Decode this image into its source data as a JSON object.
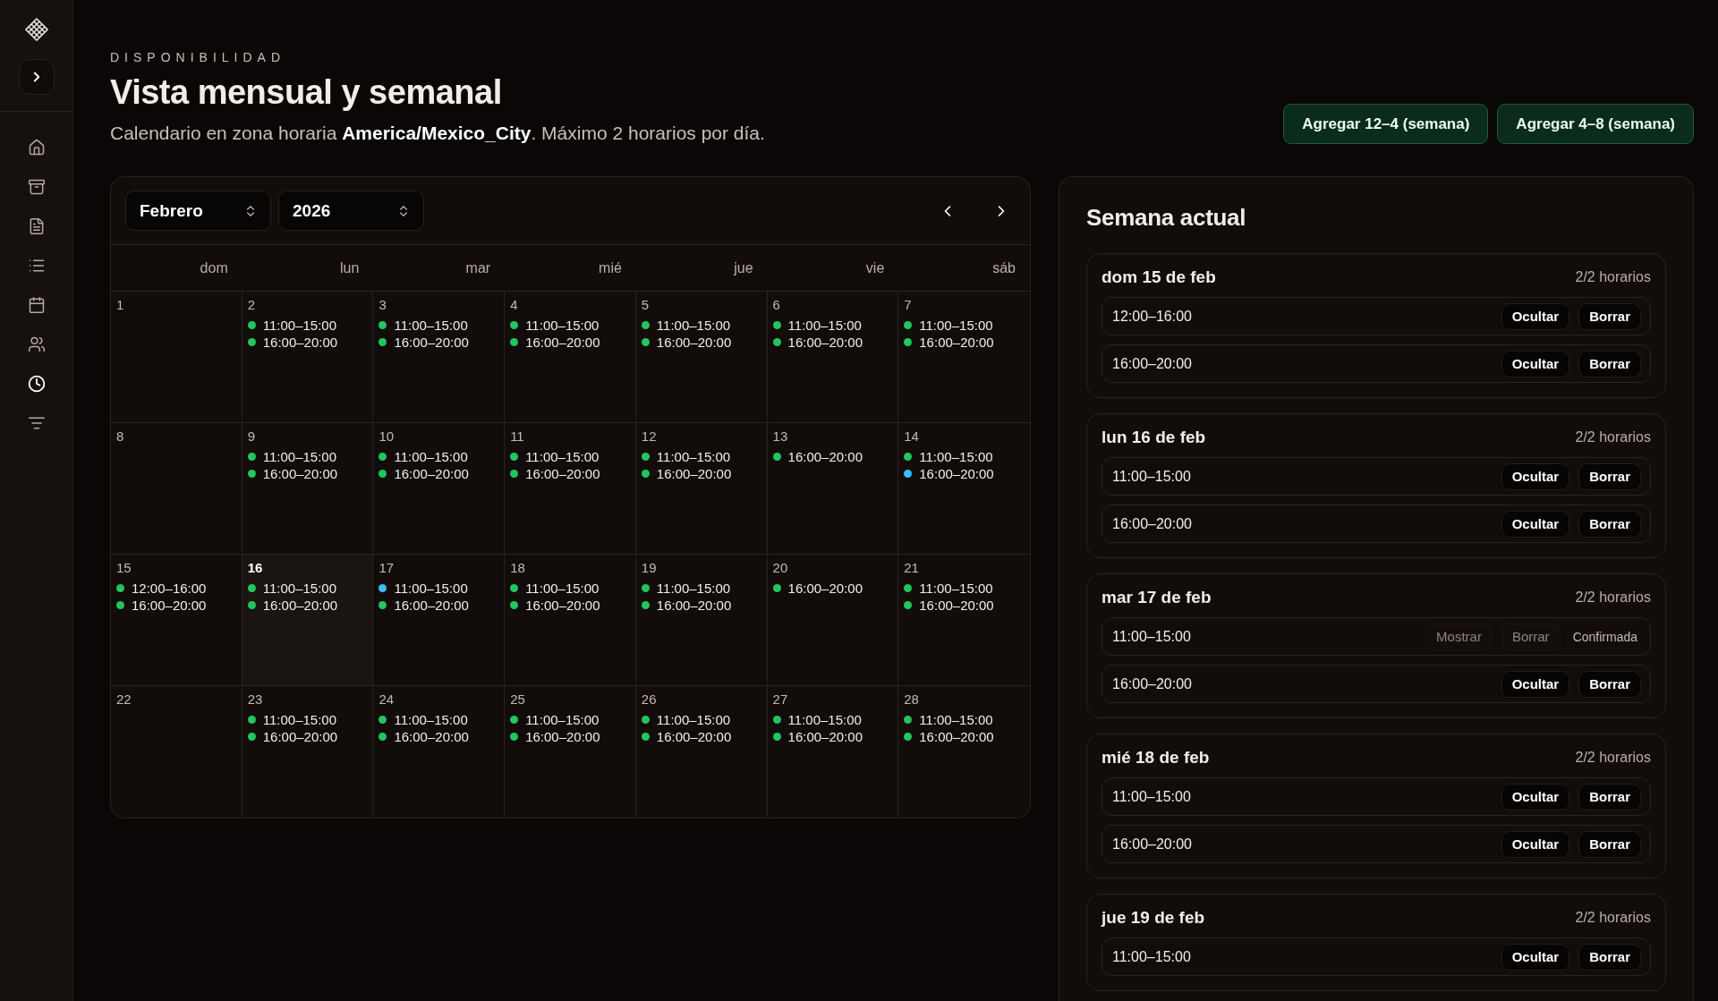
{
  "sidebar": {
    "items": [
      {
        "kind": "home",
        "selected": false
      },
      {
        "kind": "archive",
        "selected": false
      },
      {
        "kind": "file",
        "selected": false
      },
      {
        "kind": "list",
        "selected": false
      },
      {
        "kind": "calendar",
        "selected": false
      },
      {
        "kind": "users",
        "selected": false
      },
      {
        "kind": "clock",
        "selected": true
      },
      {
        "kind": "lines",
        "selected": false
      }
    ]
  },
  "header": {
    "eyebrow": "DISPONIBILIDAD",
    "title": "Vista mensual y semanal",
    "subtitle": "Calendario en zona horaria **America/Mexico_City**. Máximo 2 horarios por día.",
    "buttons": [
      "Agregar 12–4 (semana)",
      "Agregar 4–8 (semana)"
    ]
  },
  "calendar": {
    "month_select": "Febrero",
    "year_select": "2026",
    "weekdays": [
      "dom",
      "lun",
      "mar",
      "mié",
      "jue",
      "vie",
      "sáb"
    ],
    "weeks": [
      [
        {
          "day": "1",
          "today": false
        },
        {
          "day": "2",
          "today": false,
          "slots": [
            {
              "time": "11:00–15:00",
              "color": "#22c55e"
            },
            {
              "time": "16:00–20:00",
              "color": "#22c55e"
            }
          ]
        },
        {
          "day": "3",
          "today": false,
          "slots": [
            {
              "time": "11:00–15:00",
              "color": "#22c55e"
            },
            {
              "time": "16:00–20:00",
              "color": "#22c55e"
            }
          ]
        },
        {
          "day": "4",
          "today": false,
          "slots": [
            {
              "time": "11:00–15:00",
              "color": "#22c55e"
            },
            {
              "time": "16:00–20:00",
              "color": "#22c55e"
            }
          ]
        },
        {
          "day": "5",
          "today": false,
          "slots": [
            {
              "time": "11:00–15:00",
              "color": "#22c55e"
            },
            {
              "time": "16:00–20:00",
              "color": "#22c55e"
            }
          ]
        },
        {
          "day": "6",
          "today": false,
          "slots": [
            {
              "time": "11:00–15:00",
              "color": "#22c55e"
            },
            {
              "time": "16:00–20:00",
              "color": "#22c55e"
            }
          ]
        },
        {
          "day": "7",
          "today": false,
          "slots": [
            {
              "time": "11:00–15:00",
              "color": "#22c55e"
            },
            {
              "time": "16:00–20:00",
              "color": "#22c55e"
            }
          ]
        }
      ],
      [
        {
          "day": "8",
          "today": false
        },
        {
          "day": "9",
          "today": false,
          "slots": [
            {
              "time": "11:00–15:00",
              "color": "#22c55e"
            },
            {
              "time": "16:00–20:00",
              "color": "#22c55e"
            }
          ]
        },
        {
          "day": "10",
          "today": false,
          "slots": [
            {
              "time": "11:00–15:00",
              "color": "#22c55e"
            },
            {
              "time": "16:00–20:00",
              "color": "#22c55e"
            }
          ]
        },
        {
          "day": "11",
          "today": false,
          "slots": [
            {
              "time": "11:00–15:00",
              "color": "#22c55e"
            },
            {
              "time": "16:00–20:00",
              "color": "#22c55e"
            }
          ]
        },
        {
          "day": "12",
          "today": false,
          "slots": [
            {
              "time": "11:00–15:00",
              "color": "#22c55e"
            },
            {
              "time": "16:00–20:00",
              "color": "#22c55e"
            }
          ]
        },
        {
          "day": "13",
          "today": false,
          "slots": [
            {
              "time": "16:00–20:00",
              "color": "#22c55e"
            }
          ]
        },
        {
          "day": "14",
          "today": false,
          "slots": [
            {
              "time": "11:00–15:00",
              "color": "#22c55e"
            },
            {
              "time": "16:00–20:00",
              "color": "#38bdf8"
            }
          ]
        }
      ],
      [
        {
          "day": "15",
          "today": false,
          "slots": [
            {
              "time": "12:00–16:00",
              "color": "#22c55e"
            },
            {
              "time": "16:00–20:00",
              "color": "#22c55e"
            }
          ]
        },
        {
          "day": "16",
          "today": true,
          "slots": [
            {
              "time": "11:00–15:00",
              "color": "#22c55e"
            },
            {
              "time": "16:00–20:00",
              "color": "#22c55e"
            }
          ]
        },
        {
          "day": "17",
          "today": false,
          "slots": [
            {
              "time": "11:00–15:00",
              "color": "#38bdf8"
            },
            {
              "time": "16:00–20:00",
              "color": "#22c55e"
            }
          ]
        },
        {
          "day": "18",
          "today": false,
          "slots": [
            {
              "time": "11:00–15:00",
              "color": "#22c55e"
            },
            {
              "time": "16:00–20:00",
              "color": "#22c55e"
            }
          ]
        },
        {
          "day": "19",
          "today": false,
          "slots": [
            {
              "time": "11:00–15:00",
              "color": "#22c55e"
            },
            {
              "time": "16:00–20:00",
              "color": "#22c55e"
            }
          ]
        },
        {
          "day": "20",
          "today": false,
          "slots": [
            {
              "time": "16:00–20:00",
              "color": "#22c55e"
            }
          ]
        },
        {
          "day": "21",
          "today": false,
          "slots": [
            {
              "time": "11:00–15:00",
              "color": "#22c55e"
            },
            {
              "time": "16:00–20:00",
              "color": "#22c55e"
            }
          ]
        }
      ],
      [
        {
          "day": "22",
          "today": false
        },
        {
          "day": "23",
          "today": false,
          "slots": [
            {
              "time": "11:00–15:00",
              "color": "#22c55e"
            },
            {
              "time": "16:00–20:00",
              "color": "#22c55e"
            }
          ]
        },
        {
          "day": "24",
          "today": false,
          "slots": [
            {
              "time": "11:00–15:00",
              "color": "#22c55e"
            },
            {
              "time": "16:00–20:00",
              "color": "#22c55e"
            }
          ]
        },
        {
          "day": "25",
          "today": false,
          "slots": [
            {
              "time": "11:00–15:00",
              "color": "#22c55e"
            },
            {
              "time": "16:00–20:00",
              "color": "#22c55e"
            }
          ]
        },
        {
          "day": "26",
          "today": false,
          "slots": [
            {
              "time": "11:00–15:00",
              "color": "#22c55e"
            },
            {
              "time": "16:00–20:00",
              "color": "#22c55e"
            }
          ]
        },
        {
          "day": "27",
          "today": false,
          "slots": [
            {
              "time": "11:00–15:00",
              "color": "#22c55e"
            },
            {
              "time": "16:00–20:00",
              "color": "#22c55e"
            }
          ]
        },
        {
          "day": "28",
          "today": false,
          "slots": [
            {
              "time": "11:00–15:00",
              "color": "#22c55e"
            },
            {
              "time": "16:00–20:00",
              "color": "#22c55e"
            }
          ]
        }
      ]
    ]
  },
  "week_panel": {
    "title": "Semana actual",
    "days": [
      {
        "title": "dom 15 de feb",
        "count": "2/2 horarios",
        "slots": [
          {
            "time": "12:00–16:00",
            "actions": [
              {
                "label": "Ocultar",
                "disabled": false
              },
              {
                "label": "Borrar",
                "disabled": false
              }
            ]
          },
          {
            "time": "16:00–20:00",
            "actions": [
              {
                "label": "Ocultar",
                "disabled": false
              },
              {
                "label": "Borrar",
                "disabled": false
              }
            ]
          }
        ]
      },
      {
        "title": "lun 16 de feb",
        "count": "2/2 horarios",
        "slots": [
          {
            "time": "11:00–15:00",
            "actions": [
              {
                "label": "Ocultar",
                "disabled": false
              },
              {
                "label": "Borrar",
                "disabled": false
              }
            ]
          },
          {
            "time": "16:00–20:00",
            "actions": [
              {
                "label": "Ocultar",
                "disabled": false
              },
              {
                "label": "Borrar",
                "disabled": false
              }
            ]
          }
        ]
      },
      {
        "title": "mar 17 de feb",
        "count": "2/2 horarios",
        "slots": [
          {
            "time": "11:00–15:00",
            "actions": [
              {
                "label": "Mostrar",
                "disabled": true
              },
              {
                "label": "Borrar",
                "disabled": true
              }
            ],
            "status": "Confirmada"
          },
          {
            "time": "16:00–20:00",
            "actions": [
              {
                "label": "Ocultar",
                "disabled": false
              },
              {
                "label": "Borrar",
                "disabled": false
              }
            ]
          }
        ]
      },
      {
        "title": "mié 18 de feb",
        "count": "2/2 horarios",
        "slots": [
          {
            "time": "11:00–15:00",
            "actions": [
              {
                "label": "Ocultar",
                "disabled": false
              },
              {
                "label": "Borrar",
                "disabled": false
              }
            ]
          },
          {
            "time": "16:00–20:00",
            "actions": [
              {
                "label": "Ocultar",
                "disabled": false
              },
              {
                "label": "Borrar",
                "disabled": false
              }
            ]
          }
        ]
      },
      {
        "title": "jue 19 de feb",
        "count": "2/2 horarios",
        "slots": [
          {
            "time": "11:00–15:00",
            "actions": [
              {
                "label": "Ocultar",
                "disabled": false
              },
              {
                "label": "Borrar",
                "disabled": false
              }
            ]
          }
        ]
      }
    ]
  }
}
